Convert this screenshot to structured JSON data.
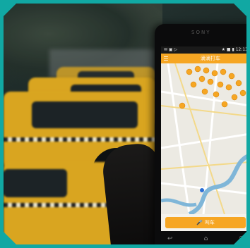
{
  "phone": {
    "brand": "SONY",
    "status": {
      "left": "✉ ▣ ▷",
      "right": "★ ■ ▮ 12:13"
    },
    "app_title": "滴滴打车",
    "menu_icon": "menu-icon",
    "bottom_button": "叫车",
    "mic_icon": "🎤",
    "nav": {
      "back": "↩",
      "home": "⌂",
      "recent": "▢"
    }
  },
  "colors": {
    "accent": "#f6a623",
    "border": "#11a8a3",
    "taxi": "#d9a520"
  }
}
